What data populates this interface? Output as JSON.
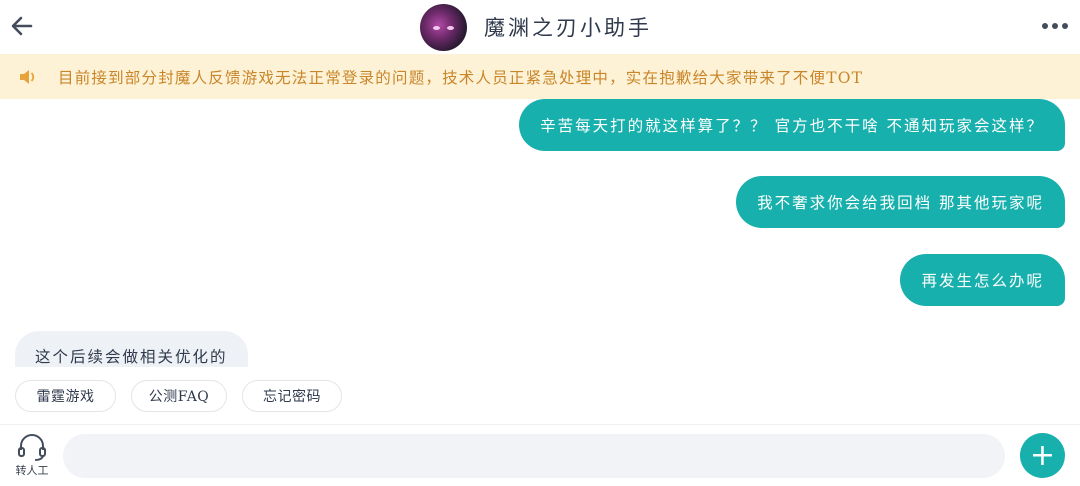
{
  "header": {
    "title": "魔渊之刃小助手",
    "back_icon": "arrow-left-icon",
    "more_icon": "more-horizontal-icon"
  },
  "notice": {
    "icon": "speaker-icon",
    "text": "目前接到部分封魔人反馈游戏无法正常登录的问题，技术人员正紧急处理中，实在抱歉给大家带来了不便TOT"
  },
  "messages": [
    {
      "direction": "outgoing",
      "text": "辛苦每天打的就这样算了？？ 官方也不干啥 不通知玩家会这样？"
    },
    {
      "direction": "outgoing",
      "text": "我不奢求你会给我回档 那其他玩家呢"
    },
    {
      "direction": "outgoing",
      "text": "再发生怎么办呢"
    },
    {
      "direction": "incoming",
      "text": "这个后续会做相关优化的"
    }
  ],
  "quick_replies": [
    "雷霆游戏",
    "公测FAQ",
    "忘记密码"
  ],
  "composer": {
    "transfer_label": "转人工",
    "transfer_icon": "headset-icon",
    "input_value": "",
    "input_placeholder": "",
    "add_icon": "plus-icon",
    "add_label": "+"
  },
  "colors": {
    "accent": "#17b0ac",
    "notice_bg": "#fdf2d5",
    "notice_text": "#c9852a",
    "incoming_bg": "#eef1f6"
  }
}
